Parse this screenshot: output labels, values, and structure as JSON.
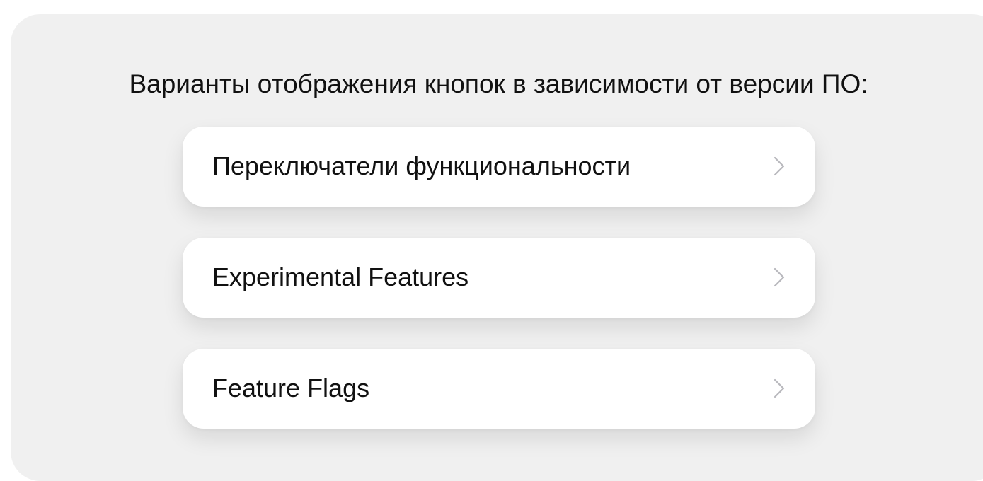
{
  "heading": "Варианты отображения кнопок в зависимости от версии ПО:",
  "options": [
    {
      "label": "Переключатели функциональности",
      "icon": "chevron-right-icon"
    },
    {
      "label": "Experimental Features",
      "icon": "chevron-right-icon"
    },
    {
      "label": "Feature Flags",
      "icon": "chevron-right-icon"
    }
  ],
  "colors": {
    "panel_background": "#f0f0f0",
    "button_background": "#ffffff",
    "text": "#111111",
    "chevron": "#b8b8bd"
  }
}
